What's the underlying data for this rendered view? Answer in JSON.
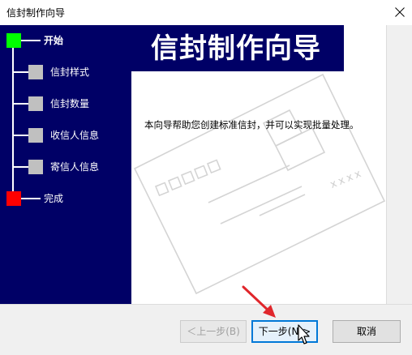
{
  "window": {
    "title": "信封制作向导",
    "close_glyph": "✕"
  },
  "header": {
    "title": "信封制作向导"
  },
  "steps": [
    {
      "label": "开始",
      "state": "current",
      "color": "#00ff00"
    },
    {
      "label": "信封样式",
      "state": "pending",
      "color": "#c0c0c0"
    },
    {
      "label": "信封数量",
      "state": "pending",
      "color": "#c0c0c0"
    },
    {
      "label": "收信人信息",
      "state": "pending",
      "color": "#c0c0c0"
    },
    {
      "label": "寄信人信息",
      "state": "pending",
      "color": "#c0c0c0"
    },
    {
      "label": "完成",
      "state": "end",
      "color": "#ff0000"
    }
  ],
  "main": {
    "description": "本向导帮助您创建标准信封，并可以实现批量处理。",
    "envelope_mark": "xxxx"
  },
  "buttons": {
    "back": "＜上一步(B)",
    "next": "下一步(N)>",
    "cancel": "取消"
  },
  "colors": {
    "sidebar_bg": "#000066",
    "annotation_arrow": "#e0262b"
  },
  "icons": {
    "close": "close-icon",
    "cursor": "mouse-pointer-icon",
    "arrow": "red-arrow-annotation"
  }
}
